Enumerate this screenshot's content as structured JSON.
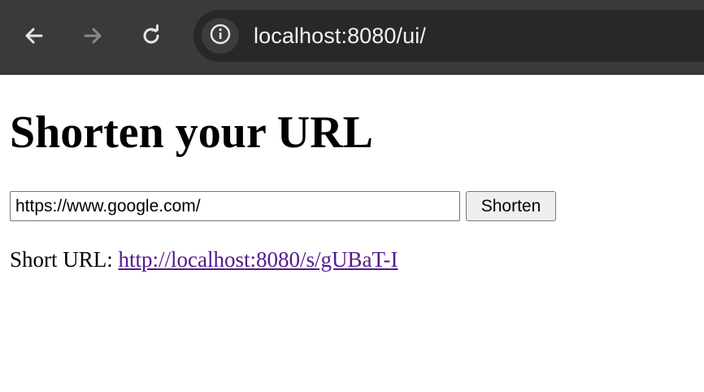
{
  "browser": {
    "url": "localhost:8080/ui/",
    "icons": {
      "back": "back-arrow-icon",
      "forward": "forward-arrow-icon",
      "reload": "reload-icon",
      "site_info": "info-icon"
    },
    "colors": {
      "toolbar_bg": "#3a3a3a",
      "omnibox_bg": "#282828",
      "forward_disabled": "#8a8a8a"
    }
  },
  "page": {
    "title": "Shorten your URL",
    "input_value": "https://www.google.com/",
    "button_label": "Shorten",
    "result_label": "Short URL: ",
    "result_link": "http://localhost:8080/s/gUBaT-I",
    "colors": {
      "visited_link": "#551a8b"
    }
  }
}
